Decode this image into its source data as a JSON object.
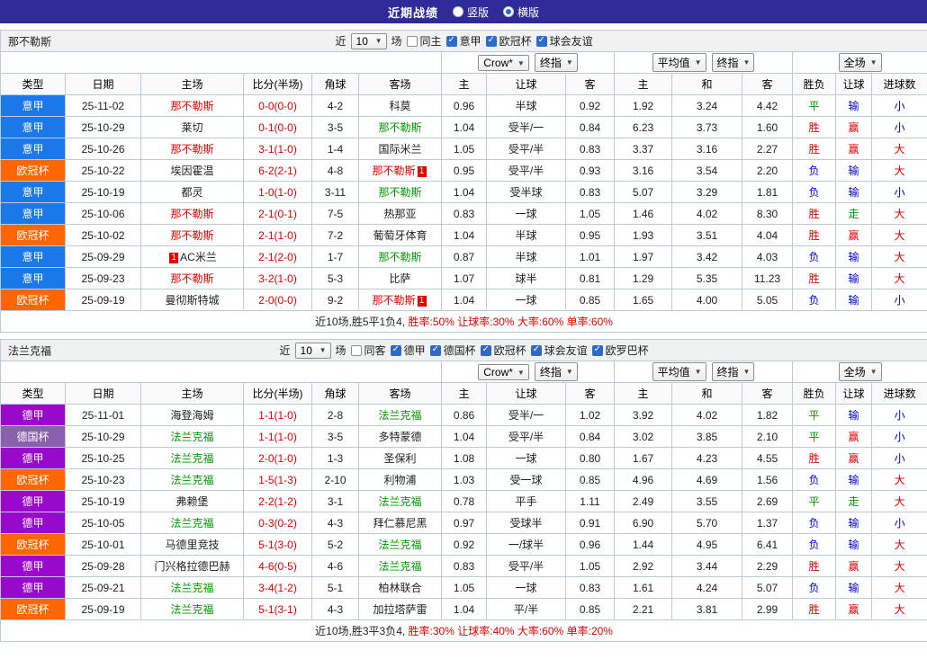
{
  "palette": {
    "topbar_bg": "#2e2b99",
    "border": "#bccadf",
    "check_blue": "#2e6bc8",
    "score": "#e60000",
    "text": {
      "red": "#e60000",
      "green": "#009900",
      "blue": "#0000e6",
      "black": "#222222"
    },
    "league": {
      "意甲": "#1a78e8",
      "欧冠杯": "#ff6600",
      "德甲": "#9909cb",
      "德国杯": "#8a5fae"
    }
  },
  "topbar": {
    "title": "近期战绩",
    "options": [
      {
        "label": "竖版",
        "selected": false
      },
      {
        "label": "横版",
        "selected": true
      }
    ]
  },
  "sections": [
    {
      "team": "那不勒斯",
      "filter": {
        "near": "近",
        "count": "10",
        "games": "场",
        "checks": [
          {
            "label": "同主",
            "checked": false
          },
          {
            "label": "意甲",
            "checked": true
          },
          {
            "label": "欧冠杯",
            "checked": true
          },
          {
            "label": "球会友谊",
            "checked": true
          }
        ]
      },
      "selects": {
        "odds_company": "Crow*",
        "odds_stage": "终指",
        "average": "平均值",
        "average_stage": "终指",
        "scope": "全场"
      },
      "columns": [
        "类型",
        "日期",
        "主场",
        "比分(半场)",
        "角球",
        "客场",
        "主",
        "让球",
        "客",
        "主",
        "和",
        "客",
        "胜负",
        "让球",
        "进球数"
      ],
      "rows": [
        {
          "league": "意甲",
          "date": "25-11-02",
          "home": {
            "name": "那不勒斯",
            "color": "red"
          },
          "score": "0-0(0-0)",
          "corner": "4-2",
          "away": {
            "name": "科莫",
            "color": "black"
          },
          "odds": [
            "0.96",
            "半球",
            "0.92"
          ],
          "avg": [
            "1.92",
            "3.24",
            "4.42"
          ],
          "result": [
            {
              "t": "平",
              "c": "green"
            },
            {
              "t": "输",
              "c": "blue"
            },
            {
              "t": "小",
              "c": "blue"
            }
          ]
        },
        {
          "league": "意甲",
          "date": "25-10-29",
          "home": {
            "name": "莱切",
            "color": "black"
          },
          "score": "0-1(0-0)",
          "corner": "3-5",
          "away": {
            "name": "那不勒斯",
            "color": "green"
          },
          "odds": [
            "1.04",
            "受半/一",
            "0.84"
          ],
          "avg": [
            "6.23",
            "3.73",
            "1.60"
          ],
          "result": [
            {
              "t": "胜",
              "c": "red"
            },
            {
              "t": "赢",
              "c": "red"
            },
            {
              "t": "小",
              "c": "blue"
            }
          ]
        },
        {
          "league": "意甲",
          "date": "25-10-26",
          "home": {
            "name": "那不勒斯",
            "color": "red"
          },
          "score": "3-1(1-0)",
          "corner": "1-4",
          "away": {
            "name": "国际米兰",
            "color": "black"
          },
          "odds": [
            "1.05",
            "受平/半",
            "0.83"
          ],
          "avg": [
            "3.37",
            "3.16",
            "2.27"
          ],
          "result": [
            {
              "t": "胜",
              "c": "red"
            },
            {
              "t": "赢",
              "c": "red"
            },
            {
              "t": "大",
              "c": "red"
            }
          ]
        },
        {
          "league": "欧冠杯",
          "date": "25-10-22",
          "home": {
            "name": "埃因霍温",
            "color": "black"
          },
          "score": "6-2(2-1)",
          "corner": "4-8",
          "away": {
            "name": "那不勒斯",
            "color": "red",
            "rc": "1",
            "rc_pos": "after"
          },
          "odds": [
            "0.95",
            "受平/半",
            "0.93"
          ],
          "avg": [
            "3.16",
            "3.54",
            "2.20"
          ],
          "result": [
            {
              "t": "负",
              "c": "blue"
            },
            {
              "t": "输",
              "c": "blue"
            },
            {
              "t": "大",
              "c": "red"
            }
          ]
        },
        {
          "league": "意甲",
          "date": "25-10-19",
          "home": {
            "name": "都灵",
            "color": "black"
          },
          "score": "1-0(1-0)",
          "corner": "3-11",
          "away": {
            "name": "那不勒斯",
            "color": "green"
          },
          "odds": [
            "1.04",
            "受半球",
            "0.83"
          ],
          "avg": [
            "5.07",
            "3.29",
            "1.81"
          ],
          "result": [
            {
              "t": "负",
              "c": "blue"
            },
            {
              "t": "输",
              "c": "blue"
            },
            {
              "t": "小",
              "c": "blue"
            }
          ]
        },
        {
          "league": "意甲",
          "date": "25-10-06",
          "home": {
            "name": "那不勒斯",
            "color": "red"
          },
          "score": "2-1(0-1)",
          "corner": "7-5",
          "away": {
            "name": "热那亚",
            "color": "black"
          },
          "odds": [
            "0.83",
            "一球",
            "1.05"
          ],
          "avg": [
            "1.46",
            "4.02",
            "8.30"
          ],
          "result": [
            {
              "t": "胜",
              "c": "red"
            },
            {
              "t": "走",
              "c": "green"
            },
            {
              "t": "大",
              "c": "red"
            }
          ]
        },
        {
          "league": "欧冠杯",
          "date": "25-10-02",
          "home": {
            "name": "那不勒斯",
            "color": "red"
          },
          "score": "2-1(1-0)",
          "corner": "7-2",
          "away": {
            "name": "葡萄牙体育",
            "color": "black"
          },
          "odds": [
            "1.04",
            "半球",
            "0.95"
          ],
          "avg": [
            "1.93",
            "3.51",
            "4.04"
          ],
          "result": [
            {
              "t": "胜",
              "c": "red"
            },
            {
              "t": "赢",
              "c": "red"
            },
            {
              "t": "大",
              "c": "red"
            }
          ]
        },
        {
          "league": "意甲",
          "date": "25-09-29",
          "home": {
            "name": "AC米兰",
            "color": "black",
            "rc": "1",
            "rc_pos": "before"
          },
          "score": "2-1(2-0)",
          "corner": "1-7",
          "away": {
            "name": "那不勒斯",
            "color": "green"
          },
          "odds": [
            "0.87",
            "半球",
            "1.01"
          ],
          "avg": [
            "1.97",
            "3.42",
            "4.03"
          ],
          "result": [
            {
              "t": "负",
              "c": "blue"
            },
            {
              "t": "输",
              "c": "blue"
            },
            {
              "t": "大",
              "c": "red"
            }
          ]
        },
        {
          "league": "意甲",
          "date": "25-09-23",
          "home": {
            "name": "那不勒斯",
            "color": "red"
          },
          "score": "3-2(1-0)",
          "corner": "5-3",
          "away": {
            "name": "比萨",
            "color": "black"
          },
          "odds": [
            "1.07",
            "球半",
            "0.81"
          ],
          "avg": [
            "1.29",
            "5.35",
            "11.23"
          ],
          "result": [
            {
              "t": "胜",
              "c": "red"
            },
            {
              "t": "输",
              "c": "blue"
            },
            {
              "t": "大",
              "c": "red"
            }
          ]
        },
        {
          "league": "欧冠杯",
          "date": "25-09-19",
          "home": {
            "name": "曼彻斯特城",
            "color": "black"
          },
          "score": "2-0(0-0)",
          "corner": "9-2",
          "away": {
            "name": "那不勒斯",
            "color": "red",
            "rc": "1",
            "rc_pos": "after"
          },
          "odds": [
            "1.04",
            "一球",
            "0.85"
          ],
          "avg": [
            "1.65",
            "4.00",
            "5.05"
          ],
          "result": [
            {
              "t": "负",
              "c": "blue"
            },
            {
              "t": "输",
              "c": "blue"
            },
            {
              "t": "小",
              "c": "blue"
            }
          ]
        }
      ],
      "summary": [
        {
          "t": "近10场,胜5平1负4, ",
          "c": "black"
        },
        {
          "t": "胜率:50% 让球率:30% 大率:60% 单率:60%",
          "c": "red"
        }
      ]
    },
    {
      "team": "法兰克福",
      "filter": {
        "near": "近",
        "count": "10",
        "games": "场",
        "checks": [
          {
            "label": "同客",
            "checked": false
          },
          {
            "label": "德甲",
            "checked": true
          },
          {
            "label": "德国杯",
            "checked": true
          },
          {
            "label": "欧冠杯",
            "checked": true
          },
          {
            "label": "球会友谊",
            "checked": true
          },
          {
            "label": "欧罗巴杯",
            "checked": true
          }
        ]
      },
      "selects": {
        "odds_company": "Crow*",
        "odds_stage": "终指",
        "average": "平均值",
        "average_stage": "终指",
        "scope": "全场"
      },
      "columns": [
        "类型",
        "日期",
        "主场",
        "比分(半场)",
        "角球",
        "客场",
        "主",
        "让球",
        "客",
        "主",
        "和",
        "客",
        "胜负",
        "让球",
        "进球数"
      ],
      "rows": [
        {
          "league": "德甲",
          "date": "25-11-01",
          "home": {
            "name": "海登海姆",
            "color": "black"
          },
          "score": "1-1(1-0)",
          "corner": "2-8",
          "away": {
            "name": "法兰克福",
            "color": "green"
          },
          "odds": [
            "0.86",
            "受半/一",
            "1.02"
          ],
          "avg": [
            "3.92",
            "4.02",
            "1.82"
          ],
          "result": [
            {
              "t": "平",
              "c": "green"
            },
            {
              "t": "输",
              "c": "blue"
            },
            {
              "t": "小",
              "c": "blue"
            }
          ]
        },
        {
          "league": "德国杯",
          "date": "25-10-29",
          "home": {
            "name": "法兰克福",
            "color": "green"
          },
          "score": "1-1(1-0)",
          "corner": "3-5",
          "away": {
            "name": "多特蒙德",
            "color": "black"
          },
          "odds": [
            "1.04",
            "受平/半",
            "0.84"
          ],
          "avg": [
            "3.02",
            "3.85",
            "2.10"
          ],
          "result": [
            {
              "t": "平",
              "c": "green"
            },
            {
              "t": "赢",
              "c": "red"
            },
            {
              "t": "小",
              "c": "blue"
            }
          ]
        },
        {
          "league": "德甲",
          "date": "25-10-25",
          "home": {
            "name": "法兰克福",
            "color": "green"
          },
          "score": "2-0(1-0)",
          "corner": "1-3",
          "away": {
            "name": "圣保利",
            "color": "black"
          },
          "odds": [
            "1.08",
            "一球",
            "0.80"
          ],
          "avg": [
            "1.67",
            "4.23",
            "4.55"
          ],
          "result": [
            {
              "t": "胜",
              "c": "red"
            },
            {
              "t": "赢",
              "c": "red"
            },
            {
              "t": "小",
              "c": "blue"
            }
          ]
        },
        {
          "league": "欧冠杯",
          "date": "25-10-23",
          "home": {
            "name": "法兰克福",
            "color": "green"
          },
          "score": "1-5(1-3)",
          "corner": "2-10",
          "away": {
            "name": "利物浦",
            "color": "black"
          },
          "odds": [
            "1.03",
            "受一球",
            "0.85"
          ],
          "avg": [
            "4.96",
            "4.69",
            "1.56"
          ],
          "result": [
            {
              "t": "负",
              "c": "blue"
            },
            {
              "t": "输",
              "c": "blue"
            },
            {
              "t": "大",
              "c": "red"
            }
          ]
        },
        {
          "league": "德甲",
          "date": "25-10-19",
          "home": {
            "name": "弗赖堡",
            "color": "black"
          },
          "score": "2-2(1-2)",
          "corner": "3-1",
          "away": {
            "name": "法兰克福",
            "color": "green"
          },
          "odds": [
            "0.78",
            "平手",
            "1.11"
          ],
          "avg": [
            "2.49",
            "3.55",
            "2.69"
          ],
          "result": [
            {
              "t": "平",
              "c": "green"
            },
            {
              "t": "走",
              "c": "green"
            },
            {
              "t": "大",
              "c": "red"
            }
          ]
        },
        {
          "league": "德甲",
          "date": "25-10-05",
          "home": {
            "name": "法兰克福",
            "color": "green"
          },
          "score": "0-3(0-2)",
          "corner": "4-3",
          "away": {
            "name": "拜仁慕尼黑",
            "color": "black"
          },
          "odds": [
            "0.97",
            "受球半",
            "0.91"
          ],
          "avg": [
            "6.90",
            "5.70",
            "1.37"
          ],
          "result": [
            {
              "t": "负",
              "c": "blue"
            },
            {
              "t": "输",
              "c": "blue"
            },
            {
              "t": "小",
              "c": "blue"
            }
          ]
        },
        {
          "league": "欧冠杯",
          "date": "25-10-01",
          "home": {
            "name": "马德里竞技",
            "color": "black"
          },
          "score": "5-1(3-0)",
          "corner": "5-2",
          "away": {
            "name": "法兰克福",
            "color": "green"
          },
          "odds": [
            "0.92",
            "一/球半",
            "0.96"
          ],
          "avg": [
            "1.44",
            "4.95",
            "6.41"
          ],
          "result": [
            {
              "t": "负",
              "c": "blue"
            },
            {
              "t": "输",
              "c": "blue"
            },
            {
              "t": "大",
              "c": "red"
            }
          ]
        },
        {
          "league": "德甲",
          "date": "25-09-28",
          "home": {
            "name": "门兴格拉德巴赫",
            "color": "black"
          },
          "score": "4-6(0-5)",
          "corner": "4-6",
          "away": {
            "name": "法兰克福",
            "color": "green"
          },
          "odds": [
            "0.83",
            "受平/半",
            "1.05"
          ],
          "avg": [
            "2.92",
            "3.44",
            "2.29"
          ],
          "result": [
            {
              "t": "胜",
              "c": "red"
            },
            {
              "t": "赢",
              "c": "red"
            },
            {
              "t": "大",
              "c": "red"
            }
          ]
        },
        {
          "league": "德甲",
          "date": "25-09-21",
          "home": {
            "name": "法兰克福",
            "color": "green"
          },
          "score": "3-4(1-2)",
          "corner": "5-1",
          "away": {
            "name": "柏林联合",
            "color": "black"
          },
          "odds": [
            "1.05",
            "一球",
            "0.83"
          ],
          "avg": [
            "1.61",
            "4.24",
            "5.07"
          ],
          "result": [
            {
              "t": "负",
              "c": "blue"
            },
            {
              "t": "输",
              "c": "blue"
            },
            {
              "t": "大",
              "c": "red"
            }
          ]
        },
        {
          "league": "欧冠杯",
          "date": "25-09-19",
          "home": {
            "name": "法兰克福",
            "color": "green"
          },
          "score": "5-1(3-1)",
          "corner": "4-3",
          "away": {
            "name": "加拉塔萨雷",
            "color": "black"
          },
          "odds": [
            "1.04",
            "平/半",
            "0.85"
          ],
          "avg": [
            "2.21",
            "3.81",
            "2.99"
          ],
          "result": [
            {
              "t": "胜",
              "c": "red"
            },
            {
              "t": "赢",
              "c": "red"
            },
            {
              "t": "大",
              "c": "red"
            }
          ]
        }
      ],
      "summary": [
        {
          "t": "近10场,胜3平3负4, ",
          "c": "black"
        },
        {
          "t": "胜率:30% 让球率:40% 大率:60% 单率:20%",
          "c": "red"
        }
      ]
    }
  ]
}
